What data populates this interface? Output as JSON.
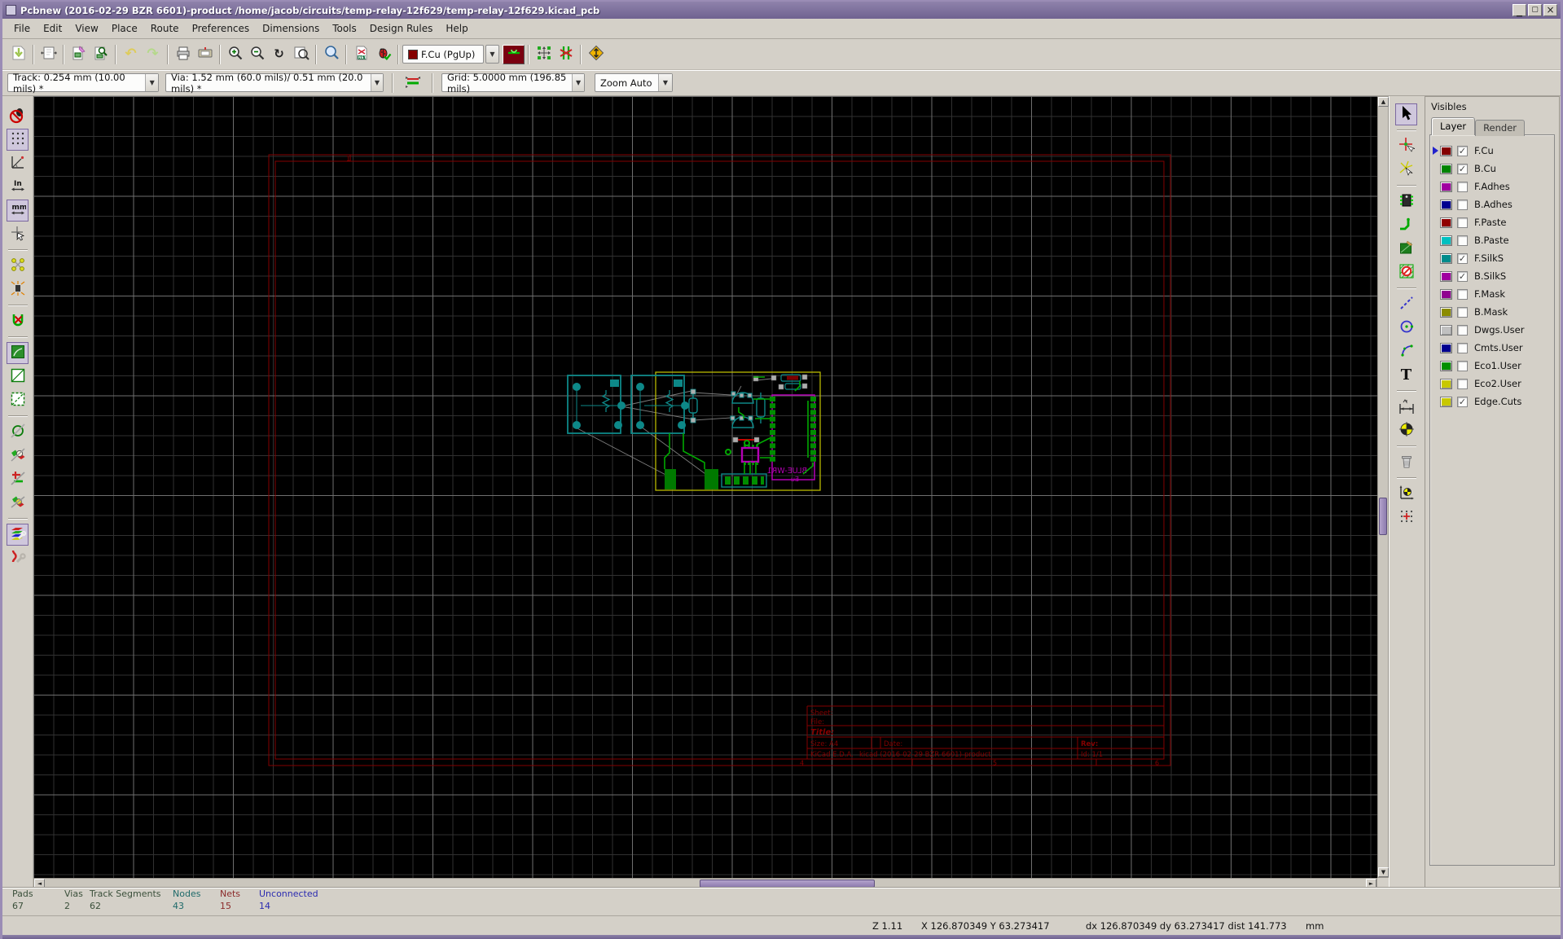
{
  "window": {
    "title": "Pcbnew (2016-02-29 BZR 6601)-product /home/jacob/circuits/temp-relay-12f629/temp-relay-12f629.kicad_pcb"
  },
  "menu_items": [
    "File",
    "Edit",
    "View",
    "Place",
    "Route",
    "Preferences",
    "Dimensions",
    "Tools",
    "Design Rules",
    "Help"
  ],
  "toolbar1": {
    "layer_selector_label": "F.Cu (PgUp)",
    "layer_selector_color": "#840000"
  },
  "toolbar2": {
    "track_label": "Track: 0.254 mm (10.00 mils) *",
    "via_label": "Via: 1.52 mm (60.0 mils)/ 0.51 mm (20.0 mils) *",
    "grid_label": "Grid: 5.0000 mm (196.85 mils)",
    "zoom_label": "Zoom Auto"
  },
  "icon_glyphs": {
    "undo": "↶",
    "redo": "↷",
    "redraw": "↻",
    "netlist": "NET",
    "inches": "In",
    "millimeters": "mm",
    "text_tool": "T"
  },
  "visibles": {
    "title": "Visibles",
    "tab_layer": "Layer",
    "tab_render": "Render",
    "layers": [
      {
        "label": "F.Cu",
        "color": "#840000",
        "checked": true,
        "current": true
      },
      {
        "label": "B.Cu",
        "color": "#008400",
        "checked": true
      },
      {
        "label": "F.Adhes",
        "color": "#a000a0",
        "checked": false
      },
      {
        "label": "B.Adhes",
        "color": "#000090",
        "checked": false
      },
      {
        "label": "F.Paste",
        "color": "#900000",
        "checked": false
      },
      {
        "label": "B.Paste",
        "color": "#00c0c0",
        "checked": false
      },
      {
        "label": "F.SilkS",
        "color": "#008c8c",
        "checked": true
      },
      {
        "label": "B.SilkS",
        "color": "#a000a0",
        "checked": true
      },
      {
        "label": "F.Mask",
        "color": "#900090",
        "checked": false
      },
      {
        "label": "B.Mask",
        "color": "#8c8c00",
        "checked": false
      },
      {
        "label": "Dwgs.User",
        "color": "#c0c0c0",
        "checked": false
      },
      {
        "label": "Cmts.User",
        "color": "#000090",
        "checked": false
      },
      {
        "label": "Eco1.User",
        "color": "#009000",
        "checked": false
      },
      {
        "label": "Eco2.User",
        "color": "#c8c800",
        "checked": false
      },
      {
        "label": "Edge.Cuts",
        "color": "#c8c800",
        "checked": true
      }
    ]
  },
  "status": {
    "items": [
      {
        "label": "Pads",
        "value": "67",
        "color": "#3a4f3a"
      },
      {
        "label": "Vias",
        "value": "2",
        "color": "#3a4f3a"
      },
      {
        "label": "Track Segments",
        "value": "62",
        "color": "#3a4f3a"
      },
      {
        "label": "Nodes",
        "value": "43",
        "color": "#1f6a6a"
      },
      {
        "label": "Nets",
        "value": "15",
        "color": "#8b2a2a"
      },
      {
        "label": "Unconnected",
        "value": "14",
        "color": "#2a2ab0"
      }
    ]
  },
  "statusbar": {
    "zoom": "Z 1.11",
    "cursor": "X 126.870349  Y 63.273417",
    "relative": "dx 126.870349  dy 63.273417  dist 141.773",
    "units": "mm"
  },
  "sheet": {
    "frame_refs": {
      "top1": "1",
      "b4": "4",
      "b5": "5",
      "b6": "6"
    },
    "titleblock": {
      "sheet": "Sheet: ",
      "file": "File: ",
      "title": "Title: ",
      "size": "Size: A4",
      "date": "Date: ",
      "rev": "Rev: ",
      "company": "KiCad E.D.A.",
      "app": "kicad (2016-02-29 BZR 6601)-product",
      "id": "Id: 1/1"
    }
  },
  "pcb": {
    "module_label": "BLUE-WR1",
    "module_value": "Eu"
  }
}
